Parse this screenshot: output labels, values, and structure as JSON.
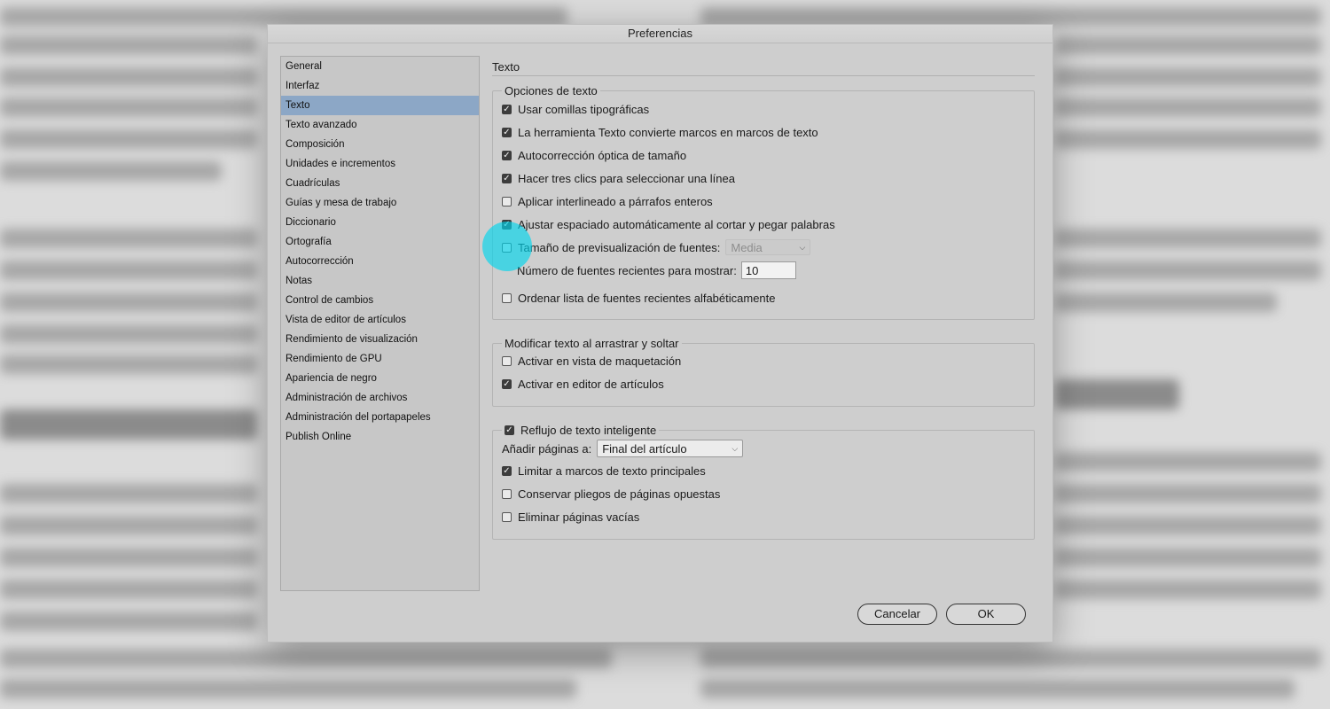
{
  "window": {
    "title": "Preferencias"
  },
  "sidebar": {
    "items": [
      {
        "label": "General"
      },
      {
        "label": "Interfaz"
      },
      {
        "label": "Texto",
        "selected": true
      },
      {
        "label": "Texto avanzado"
      },
      {
        "label": "Composición"
      },
      {
        "label": "Unidades e incrementos"
      },
      {
        "label": "Cuadrículas"
      },
      {
        "label": "Guías y mesa de trabajo"
      },
      {
        "label": "Diccionario"
      },
      {
        "label": "Ortografía"
      },
      {
        "label": "Autocorrección"
      },
      {
        "label": "Notas"
      },
      {
        "label": "Control de cambios"
      },
      {
        "label": "Vista de editor de artículos"
      },
      {
        "label": "Rendimiento de visualización"
      },
      {
        "label": "Rendimiento de GPU"
      },
      {
        "label": "Apariencia de negro"
      },
      {
        "label": "Administración de archivos"
      },
      {
        "label": "Administración del portapapeles"
      },
      {
        "label": "Publish Online"
      }
    ]
  },
  "panel": {
    "title": "Texto",
    "text_options": {
      "label": "Opciones de texto",
      "typo_quotes": {
        "label": "Usar comillas tipográficas",
        "checked": true
      },
      "type_tool_converts": {
        "label": "La herramienta Texto convierte marcos en marcos de texto",
        "checked": true
      },
      "optical_size": {
        "label": "Autocorrección óptica de tamaño",
        "checked": true
      },
      "triple_click": {
        "label": "Hacer tres clics para seleccionar una línea",
        "checked": true
      },
      "apply_leading": {
        "label": "Aplicar interlineado a párrafos enteros",
        "checked": false
      },
      "adjust_spacing": {
        "label": "Ajustar espaciado automáticamente al cortar y pegar palabras",
        "checked": true
      },
      "font_preview": {
        "label": "Tamaño de previsualización de fuentes:",
        "checked": false,
        "value": "Media"
      },
      "recent_fonts": {
        "label": "Número de fuentes recientes para mostrar:",
        "value": "10"
      },
      "sort_recent": {
        "label": "Ordenar lista de fuentes recientes alfabéticamente",
        "checked": false
      }
    },
    "drag_drop": {
      "label": "Modificar texto al arrastrar y soltar",
      "layout_view": {
        "label": "Activar en vista de maquetación",
        "checked": false
      },
      "story_editor": {
        "label": "Activar en editor de artículos",
        "checked": true
      }
    },
    "smart_reflow": {
      "label": "Reflujo de texto inteligente",
      "checked": true,
      "add_pages": {
        "label": "Añadir páginas a:",
        "value": "Final del artículo"
      },
      "limit_primary": {
        "label": "Limitar a marcos de texto principales",
        "checked": true
      },
      "preserve_spreads": {
        "label": "Conservar pliegos de páginas opuestas",
        "checked": false
      },
      "delete_empty": {
        "label": "Eliminar páginas vacías",
        "checked": false
      }
    }
  },
  "buttons": {
    "cancel": "Cancelar",
    "ok": "OK"
  },
  "colors": {
    "highlight": "#00d6ec",
    "selected_item": "#8ca7c6"
  }
}
